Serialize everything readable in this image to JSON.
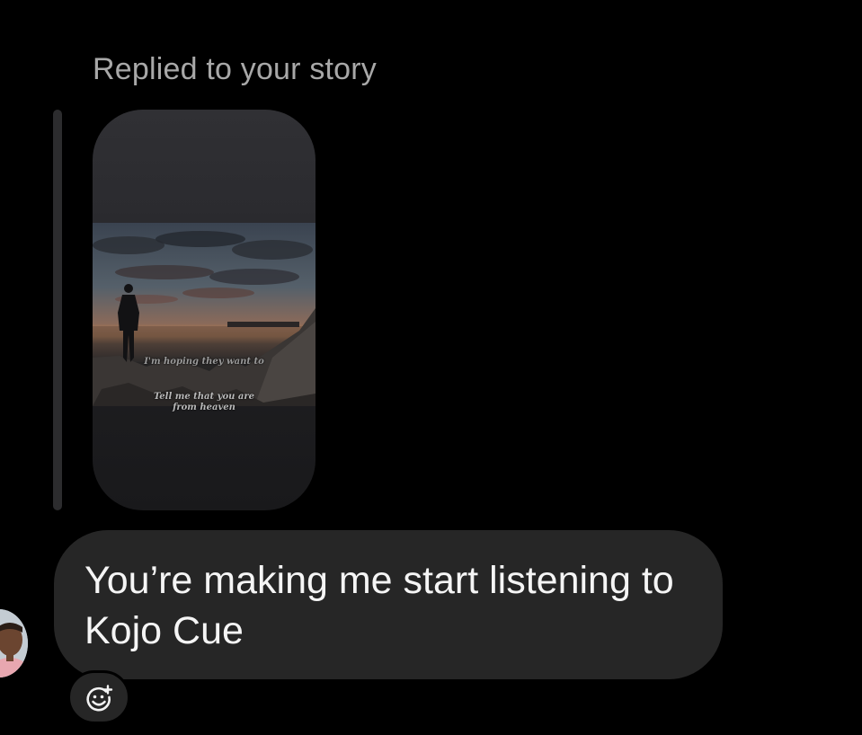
{
  "reply_header": {
    "label": "Replied to your story"
  },
  "story": {
    "caption_line_1": "I'm hoping they want to",
    "caption_line_2": "Tell me that you are from heaven",
    "image_description_icon": "story-thumbnail"
  },
  "message": {
    "text": "You’re making me start listening to Kojo Cue",
    "bubble_color": "#262626",
    "text_color": "#f5f5f5"
  },
  "reaction": {
    "icon": "add-reaction-icon"
  },
  "colors": {
    "background": "#000000",
    "secondary_text": "#a8a8a8"
  }
}
